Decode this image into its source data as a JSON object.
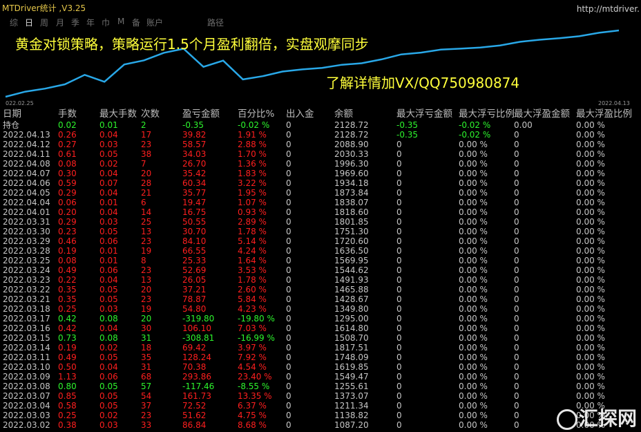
{
  "app": {
    "title": "MTDriver统计 ,V3.25",
    "url": "http://mtdriver.",
    "path_label": "路径"
  },
  "tabs": [
    "综",
    "日",
    "周",
    "月",
    "季",
    "年",
    "巾",
    "M",
    "备",
    "账户"
  ],
  "active_tab": 1,
  "chart": {
    "headline": "黄金对锁策略，策略运行1.5个月盈利翻倍，实盘观摩同步",
    "contact": "了解详情加VX/QQ750980874",
    "date_start": "022.02.25",
    "date_end": "2022.04.13",
    "line_color": "#29a8e8",
    "balance_series": [
      1000,
      1087.2,
      1138.82,
      1211.34,
      1373.07,
      1255.61,
      1549.47,
      1619.85,
      1748.09,
      1817.51,
      1508.7,
      1614.8,
      1295,
      1349.8,
      1428.67,
      1465.88,
      1491.93,
      1544.62,
      1569.95,
      1636.5,
      1720.6,
      1751.3,
      1801.85,
      1818.6,
      1838.07,
      1873.84,
      1934.18,
      1969.6,
      1996.3,
      2030.33,
      2088.9,
      2128.72
    ]
  },
  "headers": [
    "日期",
    "手数",
    "最大手数",
    "次数",
    "盈亏金额",
    "百分比%",
    "出入金",
    "余额",
    "最大浮亏金额",
    "最大浮亏比例",
    "最大浮盈金额",
    "最大浮盈比例"
  ],
  "rows": [
    {
      "date": "持仓",
      "lots": "0.02",
      "maxlots": "0.01",
      "count": "2",
      "pl": "-0.35",
      "pct": "-0.02 %",
      "io": "0",
      "bal": "2128.72",
      "mfl": "-0.35",
      "mflp": "-0.02 %",
      "mfp": "0.00",
      "mfpp": "0.00 %",
      "color": "green"
    },
    {
      "date": "2022.04.13",
      "lots": "0.26",
      "maxlots": "0.04",
      "count": "17",
      "pl": "39.82",
      "pct": "1.91 %",
      "io": "0",
      "bal": "2128.72",
      "mfl": "-0.35",
      "mflp": "-0.02 %",
      "mfp": "0",
      "mfpp": "0.00 %",
      "color": "red"
    },
    {
      "date": "2022.04.12",
      "lots": "0.27",
      "maxlots": "0.03",
      "count": "23",
      "pl": "58.57",
      "pct": "2.88 %",
      "io": "0",
      "bal": "2088.90",
      "mfl": "0",
      "mflp": "0.00 %",
      "mfp": "0",
      "mfpp": "0.00 %",
      "color": "red"
    },
    {
      "date": "2022.04.11",
      "lots": "0.61",
      "maxlots": "0.05",
      "count": "38",
      "pl": "34.03",
      "pct": "1.70 %",
      "io": "0",
      "bal": "2030.33",
      "mfl": "0",
      "mflp": "0.00 %",
      "mfp": "0",
      "mfpp": "0.00 %",
      "color": "red"
    },
    {
      "date": "2022.04.08",
      "lots": "0.08",
      "maxlots": "0.02",
      "count": "7",
      "pl": "26.70",
      "pct": "1.36 %",
      "io": "0",
      "bal": "1996.30",
      "mfl": "0",
      "mflp": "0.00 %",
      "mfp": "0",
      "mfpp": "0.00 %",
      "color": "red"
    },
    {
      "date": "2022.04.07",
      "lots": "0.30",
      "maxlots": "0.04",
      "count": "20",
      "pl": "35.42",
      "pct": "1.83 %",
      "io": "0",
      "bal": "1969.60",
      "mfl": "0",
      "mflp": "0.00 %",
      "mfp": "0",
      "mfpp": "0.00 %",
      "color": "red"
    },
    {
      "date": "2022.04.06",
      "lots": "0.59",
      "maxlots": "0.07",
      "count": "28",
      "pl": "60.34",
      "pct": "3.22 %",
      "io": "0",
      "bal": "1934.18",
      "mfl": "0",
      "mflp": "0.00 %",
      "mfp": "0",
      "mfpp": "0.00 %",
      "color": "red"
    },
    {
      "date": "2022.04.05",
      "lots": "0.29",
      "maxlots": "0.04",
      "count": "21",
      "pl": "35.77",
      "pct": "1.95 %",
      "io": "0",
      "bal": "1873.84",
      "mfl": "0",
      "mflp": "0.00 %",
      "mfp": "0",
      "mfpp": "0.00 %",
      "color": "red"
    },
    {
      "date": "2022.04.04",
      "lots": "0.06",
      "maxlots": "0.01",
      "count": "6",
      "pl": "19.47",
      "pct": "1.07 %",
      "io": "0",
      "bal": "1838.07",
      "mfl": "0",
      "mflp": "0.00 %",
      "mfp": "0",
      "mfpp": "0.00 %",
      "color": "red"
    },
    {
      "date": "2022.04.01",
      "lots": "0.20",
      "maxlots": "0.04",
      "count": "14",
      "pl": "16.75",
      "pct": "0.93 %",
      "io": "0",
      "bal": "1818.60",
      "mfl": "0",
      "mflp": "0.00 %",
      "mfp": "0",
      "mfpp": "0.00 %",
      "color": "red"
    },
    {
      "date": "2022.03.31",
      "lots": "0.29",
      "maxlots": "0.03",
      "count": "25",
      "pl": "50.55",
      "pct": "2.89 %",
      "io": "0",
      "bal": "1801.85",
      "mfl": "0",
      "mflp": "0.00 %",
      "mfp": "0",
      "mfpp": "0.00 %",
      "color": "red"
    },
    {
      "date": "2022.03.30",
      "lots": "0.23",
      "maxlots": "0.05",
      "count": "13",
      "pl": "30.70",
      "pct": "1.78 %",
      "io": "0",
      "bal": "1751.30",
      "mfl": "0",
      "mflp": "0.00 %",
      "mfp": "0",
      "mfpp": "0.00 %",
      "color": "red"
    },
    {
      "date": "2022.03.29",
      "lots": "0.46",
      "maxlots": "0.06",
      "count": "23",
      "pl": "84.10",
      "pct": "5.14 %",
      "io": "0",
      "bal": "1720.60",
      "mfl": "0",
      "mflp": "0.00 %",
      "mfp": "0",
      "mfpp": "0.00 %",
      "color": "red"
    },
    {
      "date": "2022.03.28",
      "lots": "0.19",
      "maxlots": "0.01",
      "count": "19",
      "pl": "66.55",
      "pct": "4.24 %",
      "io": "0",
      "bal": "1636.50",
      "mfl": "0",
      "mflp": "0.00 %",
      "mfp": "0",
      "mfpp": "0.00 %",
      "color": "red"
    },
    {
      "date": "2022.03.25",
      "lots": "0.08",
      "maxlots": "0.01",
      "count": "8",
      "pl": "25.33",
      "pct": "1.64 %",
      "io": "0",
      "bal": "1569.95",
      "mfl": "0",
      "mflp": "0.00 %",
      "mfp": "0",
      "mfpp": "0.00 %",
      "color": "red"
    },
    {
      "date": "2022.03.24",
      "lots": "0.49",
      "maxlots": "0.06",
      "count": "23",
      "pl": "52.69",
      "pct": "3.53 %",
      "io": "0",
      "bal": "1544.62",
      "mfl": "0",
      "mflp": "0.00 %",
      "mfp": "0",
      "mfpp": "0.00 %",
      "color": "red"
    },
    {
      "date": "2022.03.23",
      "lots": "0.22",
      "maxlots": "0.04",
      "count": "13",
      "pl": "26.05",
      "pct": "1.78 %",
      "io": "0",
      "bal": "1491.93",
      "mfl": "0",
      "mflp": "0.00 %",
      "mfp": "0",
      "mfpp": "0.00 %",
      "color": "red"
    },
    {
      "date": "2022.03.22",
      "lots": "0.35",
      "maxlots": "0.05",
      "count": "20",
      "pl": "37.21",
      "pct": "2.60 %",
      "io": "0",
      "bal": "1465.88",
      "mfl": "0",
      "mflp": "0.00 %",
      "mfp": "0",
      "mfpp": "0.00 %",
      "color": "red"
    },
    {
      "date": "2022.03.21",
      "lots": "0.35",
      "maxlots": "0.05",
      "count": "23",
      "pl": "78.87",
      "pct": "5.84 %",
      "io": "0",
      "bal": "1428.67",
      "mfl": "0",
      "mflp": "0.00 %",
      "mfp": "0",
      "mfpp": "0.00 %",
      "color": "red"
    },
    {
      "date": "2022.03.18",
      "lots": "0.25",
      "maxlots": "0.03",
      "count": "19",
      "pl": "54.80",
      "pct": "4.23 %",
      "io": "0",
      "bal": "1349.80",
      "mfl": "0",
      "mflp": "0.00 %",
      "mfp": "0",
      "mfpp": "0.00 %",
      "color": "red"
    },
    {
      "date": "2022.03.17",
      "lots": "0.42",
      "maxlots": "0.08",
      "count": "20",
      "pl": "-319.80",
      "pct": "-19.80 %",
      "io": "0",
      "bal": "1295.00",
      "mfl": "0",
      "mflp": "0.00 %",
      "mfp": "0",
      "mfpp": "0.00 %",
      "color": "green"
    },
    {
      "date": "2022.03.16",
      "lots": "0.42",
      "maxlots": "0.04",
      "count": "30",
      "pl": "106.10",
      "pct": "7.03 %",
      "io": "0",
      "bal": "1614.80",
      "mfl": "0",
      "mflp": "0.00 %",
      "mfp": "0",
      "mfpp": "0.00 %",
      "color": "red"
    },
    {
      "date": "2022.03.15",
      "lots": "0.73",
      "maxlots": "0.08",
      "count": "31",
      "pl": "-308.81",
      "pct": "-16.99 %",
      "io": "0",
      "bal": "1508.70",
      "mfl": "0",
      "mflp": "0.00 %",
      "mfp": "0",
      "mfpp": "0.00 %",
      "color": "green"
    },
    {
      "date": "2022.03.14",
      "lots": "0.19",
      "maxlots": "0.02",
      "count": "18",
      "pl": "69.42",
      "pct": "3.97 %",
      "io": "0",
      "bal": "1817.51",
      "mfl": "0",
      "mflp": "0.00 %",
      "mfp": "0",
      "mfpp": "0.00 %",
      "color": "red"
    },
    {
      "date": "2022.03.11",
      "lots": "0.49",
      "maxlots": "0.05",
      "count": "35",
      "pl": "128.24",
      "pct": "7.92 %",
      "io": "0",
      "bal": "1748.09",
      "mfl": "0",
      "mflp": "0.00 %",
      "mfp": "0",
      "mfpp": "0.00 %",
      "color": "red"
    },
    {
      "date": "2022.03.10",
      "lots": "0.50",
      "maxlots": "0.04",
      "count": "31",
      "pl": "70.38",
      "pct": "4.54 %",
      "io": "0",
      "bal": "1619.85",
      "mfl": "0",
      "mflp": "0.00 %",
      "mfp": "0",
      "mfpp": "0.00 %",
      "color": "red"
    },
    {
      "date": "2022.03.09",
      "lots": "1.13",
      "maxlots": "0.06",
      "count": "68",
      "pl": "293.86",
      "pct": "23.40 %",
      "io": "0",
      "bal": "1549.47",
      "mfl": "0",
      "mflp": "0.00 %",
      "mfp": "0",
      "mfpp": "0.00 %",
      "color": "red"
    },
    {
      "date": "2022.03.08",
      "lots": "0.80",
      "maxlots": "0.05",
      "count": "57",
      "pl": "-117.46",
      "pct": "-8.55 %",
      "io": "0",
      "bal": "1255.61",
      "mfl": "0",
      "mflp": "0.00 %",
      "mfp": "0",
      "mfpp": "0.00 %",
      "color": "green"
    },
    {
      "date": "2022.03.07",
      "lots": "0.85",
      "maxlots": "0.05",
      "count": "54",
      "pl": "161.73",
      "pct": "13.35 %",
      "io": "0",
      "bal": "1373.07",
      "mfl": "0",
      "mflp": "0.00 %",
      "mfp": "0",
      "mfpp": "0.00 %",
      "color": "red"
    },
    {
      "date": "2022.03.04",
      "lots": "0.58",
      "maxlots": "0.05",
      "count": "37",
      "pl": "72.52",
      "pct": "6.37 %",
      "io": "0",
      "bal": "1211.34",
      "mfl": "0",
      "mflp": "0.00 %",
      "mfp": "0",
      "mfpp": "0.00 %",
      "color": "red"
    },
    {
      "date": "2022.03.03",
      "lots": "0.25",
      "maxlots": "0.02",
      "count": "23",
      "pl": "51.62",
      "pct": "4.75 %",
      "io": "0",
      "bal": "1138.82",
      "mfl": "0",
      "mflp": "0.00 %",
      "mfp": "0",
      "mfpp": "0.00 %",
      "color": "red"
    },
    {
      "date": "2022.03.02",
      "lots": "0.38",
      "maxlots": "0.03",
      "count": "33",
      "pl": "86.84",
      "pct": "8.68 %",
      "io": "0",
      "bal": "1087.20",
      "mfl": "0",
      "mflp": "0.00 %",
      "mfp": "0",
      "mfpp": "0.00 %",
      "color": "red"
    }
  ],
  "watermark": {
    "text": "汇探网"
  }
}
